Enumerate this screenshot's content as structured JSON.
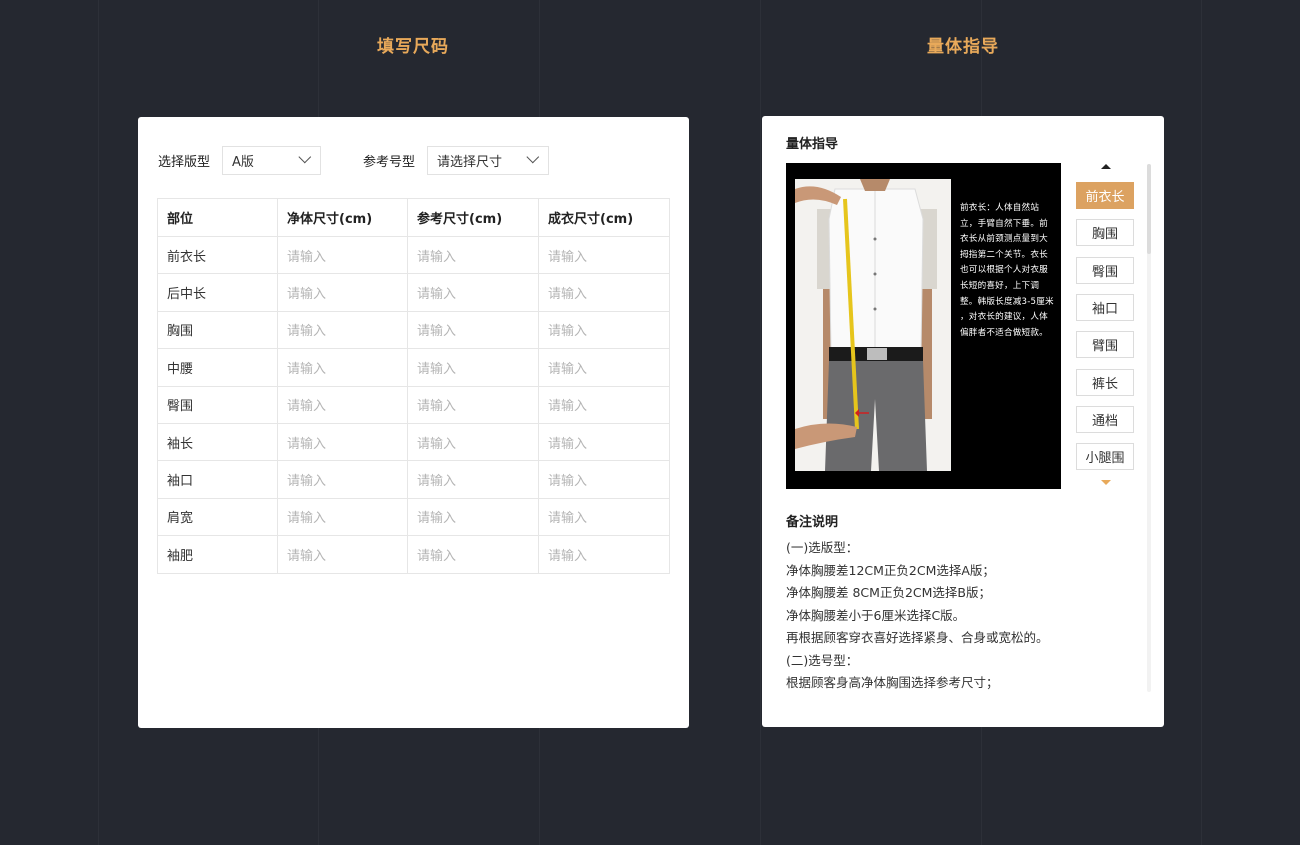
{
  "sections": {
    "left_title": "填写尺码",
    "right_title": "量体指导"
  },
  "filters": {
    "style_label": "选择版型",
    "style_value": "A版",
    "size_label": "参考号型",
    "size_value": "请选择尺寸"
  },
  "table": {
    "headers": [
      "部位",
      "净体尺寸(cm)",
      "参考尺寸(cm)",
      "成衣尺寸(cm)"
    ],
    "placeholder": "请输入",
    "rows": [
      "前衣长",
      "后中长",
      "胸围",
      "中腰",
      "臀围",
      "袖长",
      "袖口",
      "肩宽",
      "袖肥"
    ]
  },
  "guide": {
    "title": "量体指导",
    "description": "前衣长：人体自然站立，手臂自然下垂。前衣长从前颈测点量到大拇指第二个关节。衣长也可以根据个人对衣服长短的喜好，上下调整。韩版长度减3-5厘米 ，对衣长的建议，人体偏胖者不适合做短款。",
    "parts": [
      "前衣长",
      "胸围",
      "臀围",
      "袖口",
      "臂围",
      "裤长",
      "通档",
      "小腿围"
    ],
    "active_part": "前衣长",
    "active_color": "#dca261"
  },
  "notes": {
    "title": "备注说明",
    "lines": [
      "(一)选版型：",
      "净体胸腰差12CM正负2CM选择A版；",
      "净体胸腰差 8CM正负2CM选择B版；",
      "净体胸腰差小于6厘米选择C版。",
      "再根据顾客穿衣喜好选择紧身、合身或宽松的。",
      "(二)选号型：",
      "根据顾客身高净体胸围选择参考尺寸；"
    ]
  },
  "colors": {
    "background": "#252830",
    "accent": "#e8a95a"
  }
}
